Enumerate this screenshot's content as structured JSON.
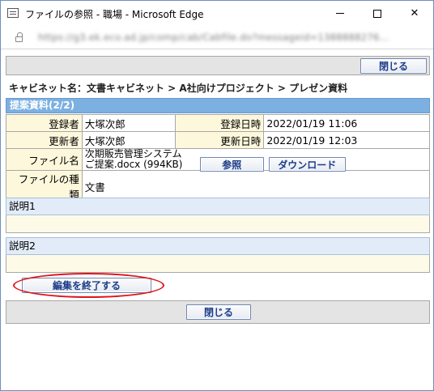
{
  "window": {
    "title": "ファイルの参照 - 職場 - Microsoft Edge",
    "url": "https://g3.ek.eco.ad.jp/comp/cab/Cabfile.do?messageid=1388888276..."
  },
  "toolbar": {
    "close_label": "閉じる"
  },
  "breadcrumb": "キャビネット名：文書キャビネット > A社向けプロジェクト > プレゼン資料",
  "section": {
    "title": "提案資料(2/2)"
  },
  "info": {
    "registrant_label": "登録者",
    "registrant_value": "大塚次郎",
    "registered_label": "登録日時",
    "registered_value": "2022/01/19 11:06",
    "updater_label": "更新者",
    "updater_value": "大塚次郎",
    "updated_label": "更新日時",
    "updated_value": "2022/01/19 12:03",
    "filename_label": "ファイル名",
    "filename_value": "次期販売管理システムご提案.docx (994KB)",
    "browse_label": "参照",
    "download_label": "ダウンロード",
    "filetype_label": "ファイルの種類",
    "filetype_value": "文書"
  },
  "descriptions": {
    "d1_label": "説明1",
    "d2_label": "説明2"
  },
  "actions": {
    "finish_edit_label": "編集を終了する"
  },
  "footer": {
    "close_label": "閉じる"
  },
  "colors": {
    "header_blue": "#7cb0e0",
    "label_bg": "#fdf8dc",
    "button_text": "#1c3c88",
    "highlight_red": "#e0141c"
  }
}
